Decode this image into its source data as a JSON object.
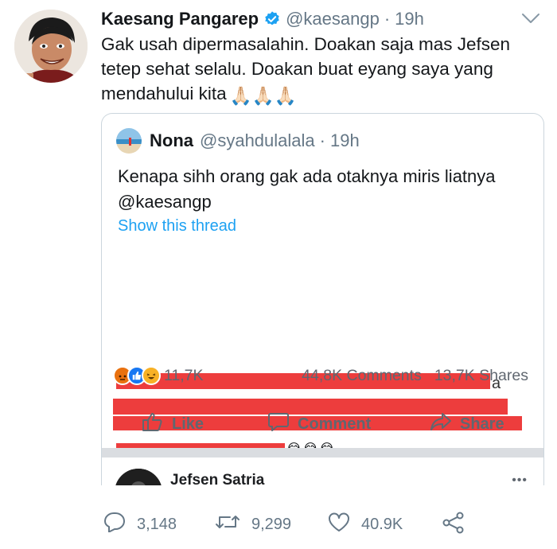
{
  "tweet": {
    "author_name": "Kaesang Pangarep",
    "author_handle": "@kaesangp",
    "separator": "·",
    "time": "19h",
    "text": "Gak usah dipermasalahin. Doakan saja mas Jefsen tetep sehat selalu. Doakan buat eyang saya yang mendahului kita",
    "emoji": "🙏🏻🙏🏻🙏🏻"
  },
  "quote": {
    "author_name": "Nona",
    "author_handle": "@syahdulalala",
    "separator": "·",
    "time": "19h",
    "text": "Kenapa sihh orang gak ada otaknya miris liatnya @kaesangp",
    "show_thread": "Show this thread"
  },
  "facebook_post": {
    "tail_char": "a",
    "laugh_emoji": [
      "😂",
      "😂",
      "😂"
    ],
    "reaction_count": "11,7K",
    "comments": "44,8K Comments",
    "shares": "13,7K Shares",
    "like_label": "Like",
    "comment_label": "Comment",
    "share_label": "Share",
    "commenter_name": "Jefsen Satria",
    "more_label": "•••"
  },
  "actions": {
    "replies": "3,148",
    "retweets": "9,299",
    "likes": "40.9K"
  },
  "colors": {
    "accent": "#1da1f2",
    "redaction": "#ed3d3d",
    "muted": "#657786"
  }
}
